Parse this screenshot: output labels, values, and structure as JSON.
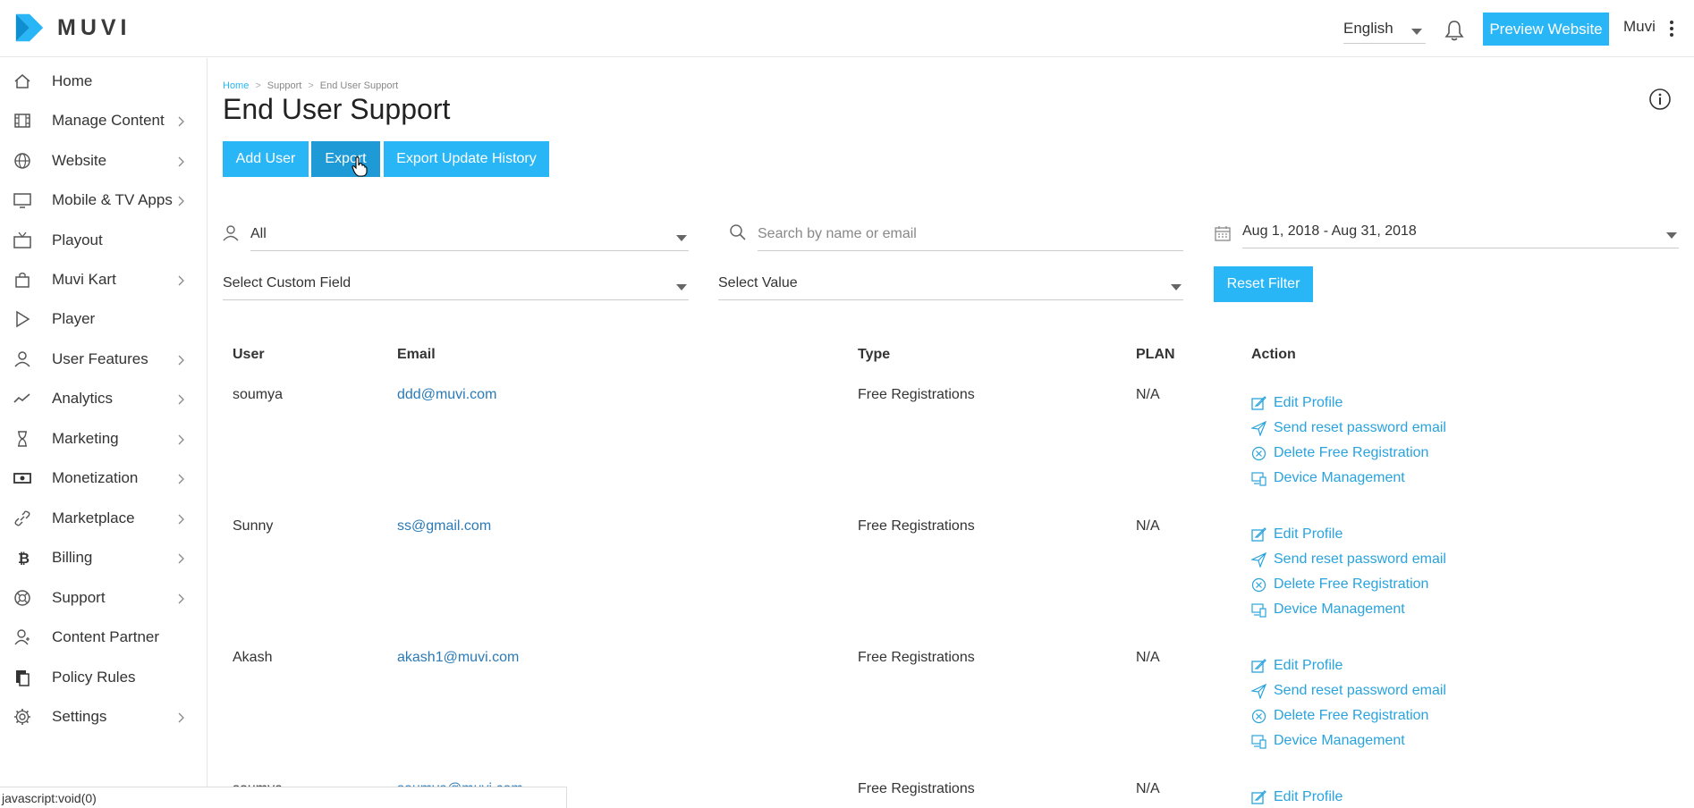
{
  "header": {
    "logo_text": "MUVI",
    "language": "English",
    "preview_label": "Preview Website",
    "user_name": "Muvi"
  },
  "sidebar": {
    "items": [
      {
        "label": "Home",
        "icon": "home-icon",
        "has_children": false
      },
      {
        "label": "Manage Content",
        "icon": "film-icon",
        "has_children": true
      },
      {
        "label": "Website",
        "icon": "globe-icon",
        "has_children": true
      },
      {
        "label": "Mobile & TV Apps",
        "icon": "monitor-icon",
        "has_children": true
      },
      {
        "label": "Playout",
        "icon": "tv-icon",
        "has_children": false
      },
      {
        "label": "Muvi Kart",
        "icon": "shopping-bag-icon",
        "has_children": true
      },
      {
        "label": "Player",
        "icon": "play-icon",
        "has_children": false
      },
      {
        "label": "User Features",
        "icon": "user-icon",
        "has_children": true
      },
      {
        "label": "Analytics",
        "icon": "trend-icon",
        "has_children": true
      },
      {
        "label": "Marketing",
        "icon": "hourglass-icon",
        "has_children": true
      },
      {
        "label": "Monetization",
        "icon": "cash-icon",
        "has_children": true
      },
      {
        "label": "Marketplace",
        "icon": "link-icon",
        "has_children": true
      },
      {
        "label": "Billing",
        "icon": "bitcoin-icon",
        "has_children": true
      },
      {
        "label": "Support",
        "icon": "lifebuoy-icon",
        "has_children": true
      },
      {
        "label": "Content Partner",
        "icon": "partner-icon",
        "has_children": false
      },
      {
        "label": "Policy Rules",
        "icon": "policy-icon",
        "has_children": false
      },
      {
        "label": "Settings",
        "icon": "gear-icon",
        "has_children": true
      }
    ]
  },
  "breadcrumb": {
    "home": "Home",
    "parent": "Support",
    "current": "End User Support",
    "separator": ">"
  },
  "page_title": "End User Support",
  "toolbar": {
    "add_user": "Add User",
    "export": "Export",
    "export_history": "Export Update History"
  },
  "filters": {
    "user_type": "All",
    "search_placeholder": "Search by name or email",
    "date_range": "Aug 1, 2018 - Aug 31, 2018",
    "custom_field": "Select Custom Field",
    "value": "Select Value",
    "reset_label": "Reset Filter"
  },
  "table": {
    "headers": {
      "user": "User",
      "email": "Email",
      "type": "Type",
      "plan": "PLAN",
      "action": "Action"
    },
    "actions": {
      "edit": "Edit Profile",
      "reset": "Send reset password email",
      "delete": "Delete Free Registration",
      "device": "Device Management"
    },
    "rows": [
      {
        "user": "soumya",
        "email": "ddd@muvi.com",
        "type": "Free Registrations",
        "plan": "N/A"
      },
      {
        "user": "Sunny",
        "email": "ss@gmail.com",
        "type": "Free Registrations",
        "plan": "N/A"
      },
      {
        "user": "Akash",
        "email": "akash1@muvi.com",
        "type": "Free Registrations",
        "plan": "N/A"
      },
      {
        "user": "soumya",
        "email": "soumya@muvi.com",
        "type": "Free Registrations",
        "plan": "N/A"
      }
    ]
  },
  "status_bar": "javascript:void(0)",
  "colors": {
    "accent": "#29b6f6",
    "accent_dark": "#1e9ad6",
    "link": "#2a7ab8"
  }
}
